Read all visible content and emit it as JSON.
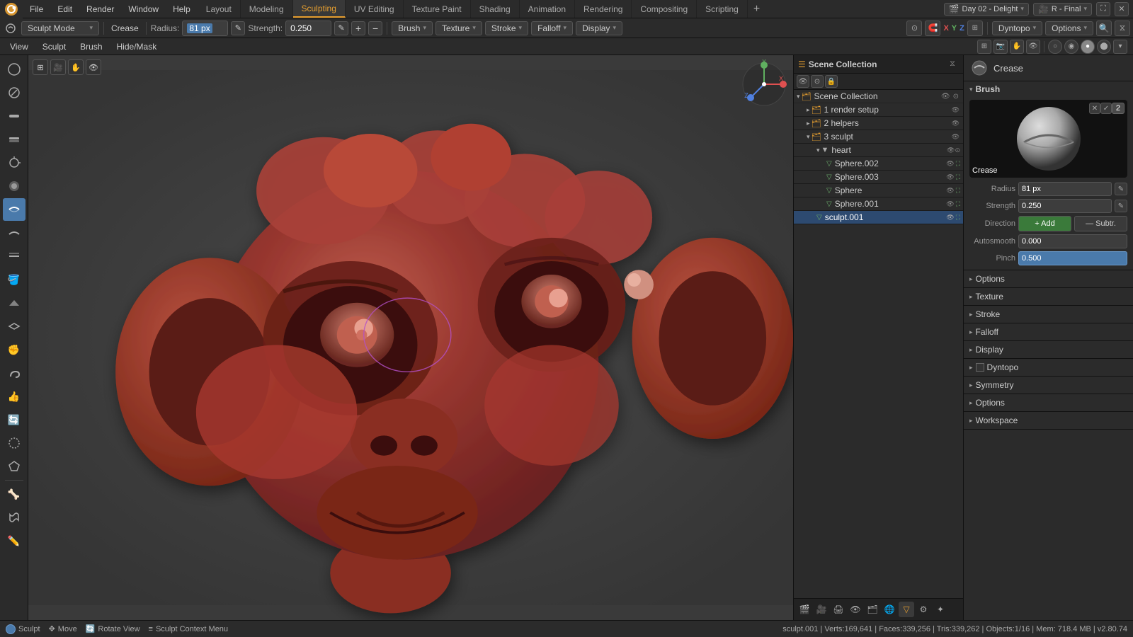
{
  "app": {
    "title": "Day 02 - Delight",
    "renderer": "R - Final"
  },
  "top_menu": {
    "items": [
      "File",
      "Edit",
      "Render",
      "Window",
      "Help"
    ]
  },
  "workspace_tabs": {
    "tabs": [
      "Layout",
      "Modeling",
      "Sculpting",
      "UV Editing",
      "Texture Paint",
      "Shading",
      "Animation",
      "Rendering",
      "Compositing",
      "Scripting"
    ],
    "active": "Sculpting",
    "plus": "+"
  },
  "second_toolbar": {
    "mode": "Sculpt Mode",
    "mode_arrow": "▾",
    "brush_name": "Crease",
    "radius_label": "Radius:",
    "radius_value": "81 px",
    "strength_label": "Strength:",
    "strength_value": "0.250",
    "plus_icon": "+",
    "minus_icon": "−",
    "brush_label": "Brush",
    "brush_arrow": "▾",
    "texture_label": "Texture",
    "texture_arrow": "▾",
    "stroke_label": "Stroke",
    "stroke_arrow": "▾",
    "falloff_label": "Falloff",
    "falloff_arrow": "▾",
    "display_label": "Display",
    "display_arrow": "▾"
  },
  "third_toolbar": {
    "items": [
      "View",
      "Sculpt",
      "Brush",
      "Hide/Mask"
    ]
  },
  "left_tools": {
    "tools": [
      "draw",
      "draw-sharp",
      "clay",
      "clay-strips",
      "clay-thumb",
      "layer",
      "inflate",
      "blob",
      "crease-active",
      "smooth",
      "flatten",
      "fill",
      "scrape",
      "multiplane-scrape",
      "pinch",
      "grab",
      "elastic-grab",
      "snake-hook",
      "thumb",
      "rotate",
      "slide-relax",
      "boundary",
      "cloth",
      "simplify",
      "mask",
      "draw-face-sets",
      "multires-disp",
      "pose",
      "nudge",
      "pen"
    ]
  },
  "viewport": {
    "overlay_icons": [
      "grid",
      "cam",
      "hand",
      "eye"
    ],
    "shading_icons": [
      "wire",
      "solid",
      "material",
      "render"
    ],
    "axis": {
      "x": "X",
      "y": "Y",
      "z": "Z"
    }
  },
  "outliner": {
    "title": "Scene Collection",
    "items": [
      {
        "name": "1 render setup",
        "indent": 1,
        "icon": "📁",
        "type": "collection",
        "visible": true
      },
      {
        "name": "2 helpers",
        "indent": 1,
        "icon": "📁",
        "type": "collection",
        "visible": true
      },
      {
        "name": "3 sculpt",
        "indent": 1,
        "icon": "📁",
        "type": "collection",
        "visible": true
      },
      {
        "name": "heart",
        "indent": 2,
        "icon": "♡",
        "type": "object",
        "visible": true
      },
      {
        "name": "Sphere.002",
        "indent": 3,
        "icon": "●",
        "type": "mesh",
        "visible": true
      },
      {
        "name": "Sphere.003",
        "indent": 3,
        "icon": "●",
        "type": "mesh",
        "visible": true
      },
      {
        "name": "Sphere",
        "indent": 3,
        "icon": "●",
        "type": "mesh",
        "visible": true
      },
      {
        "name": "Sphere.001",
        "indent": 3,
        "icon": "●",
        "type": "mesh",
        "visible": true
      },
      {
        "name": "sculpt.001",
        "indent": 2,
        "icon": "●",
        "type": "mesh",
        "visible": true,
        "selected": true
      }
    ]
  },
  "properties": {
    "brush_header": "Crease",
    "brush_num": "2",
    "section_brush": "Brush",
    "radius_label": "Radius",
    "radius_value": "81 px",
    "strength_label": "Strength",
    "strength_value": "0.250",
    "direction_label": "Direction",
    "add_label": "+ Add",
    "subtract_label": "— Subtr.",
    "autosmooth_label": "Autosmooth",
    "autosmooth_value": "0.000",
    "pinch_label": "Pinch",
    "pinch_value": "0.500",
    "section_options": "Options",
    "section_texture": "Texture",
    "section_stroke": "Stroke",
    "section_falloff": "Falloff",
    "section_display": "Display",
    "section_dyntopo": "Dyntopo",
    "section_symmetry": "Symmetry",
    "section_options2": "Options",
    "section_workspace": "Workspace"
  },
  "bottom_bar": {
    "sculpt": "Sculpt",
    "move": "Move",
    "rotate_view": "Rotate View",
    "context_menu": "Sculpt Context Menu",
    "stats": "sculpt.001 | Verts:169,641 | Faces:339,256 | Tris:339,262 | Objects:1/16 | Mem: 718.4 MB | v2.80.74"
  },
  "dyntopo_bar": {
    "label": "Dyntopo",
    "options": "Options",
    "mode": "▾"
  }
}
